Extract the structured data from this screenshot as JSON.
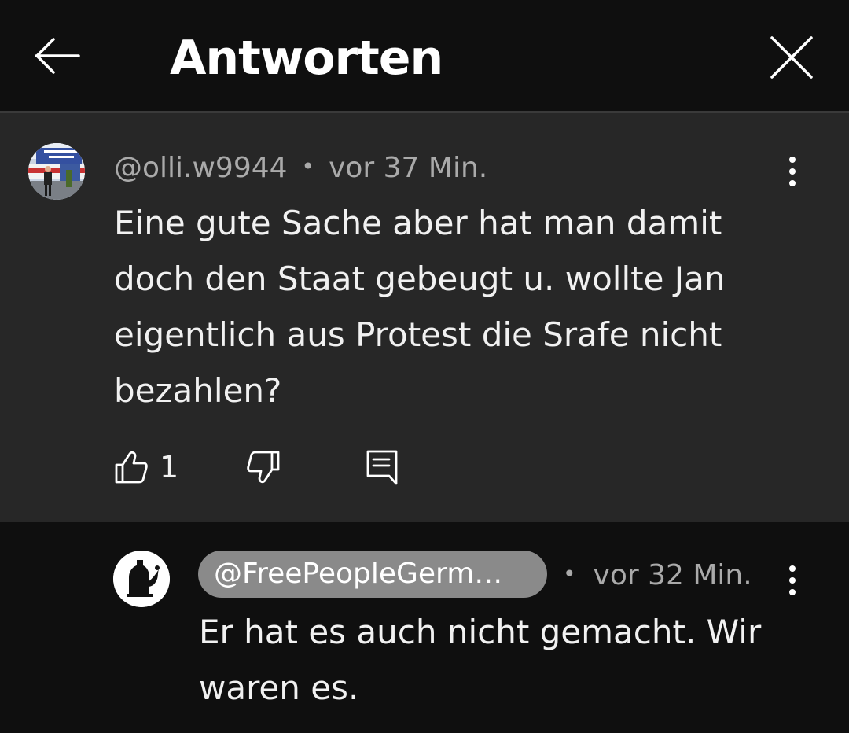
{
  "header": {
    "title": "Antworten",
    "back_icon": "arrow-left-icon",
    "close_icon": "close-icon"
  },
  "parent_comment": {
    "author": "@olli.w9944",
    "separator": "•",
    "time": "vor 37 Min.",
    "text": "Eine gute Sache aber hat man damit doch den Staat gebeugt u. wollte Jan eigentlich aus Protest die Srafe nicht bezahlen?",
    "like_count": "1",
    "icons": [
      "thumbs-up-icon",
      "thumbs-down-icon",
      "reply-comment-icon",
      "more-vertical-icon"
    ]
  },
  "reply_comment": {
    "author": "@FreePeopleGerm…",
    "separator": "•",
    "time": "vor 32 Min.",
    "text": "Er hat es auch nicht gemacht. Wir waren es.",
    "icons": [
      "more-vertical-icon"
    ]
  },
  "colors": {
    "background": "#0f0f0f",
    "parent_background": "#272727",
    "meta_text": "#aaaaaa",
    "chip": "#8a8a8a"
  }
}
